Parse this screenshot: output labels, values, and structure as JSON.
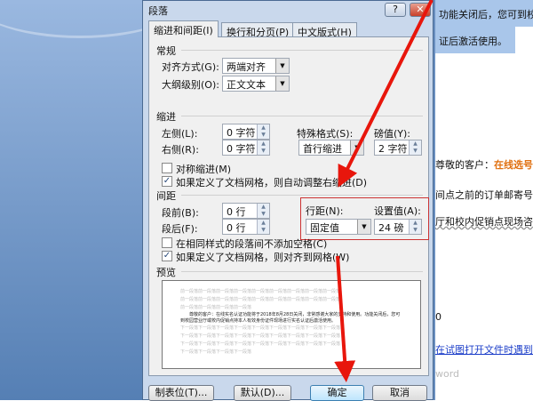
{
  "dialog": {
    "title": "段落",
    "help": "?",
    "close": "✕",
    "tabs": [
      "缩进和间距(I)",
      "换行和分页(P)",
      "中文版式(H)"
    ],
    "general": {
      "heading": "常规",
      "align_label": "对齐方式(G):",
      "align_value": "两端对齐",
      "outline_label": "大纲级别(O):",
      "outline_value": "正文文本"
    },
    "indent": {
      "heading": "缩进",
      "left_label": "左侧(L):",
      "left_value": "0 字符",
      "right_label": "右侧(R):",
      "right_value": "0 字符",
      "special_label": "特殊格式(S):",
      "special_value": "首行缩进",
      "by_label": "磅值(Y):",
      "by_value": "2 字符",
      "mirror": "对称缩进(M)",
      "auto_adjust": "如果定义了文档网格，则自动调整右缩进(D)"
    },
    "spacing": {
      "heading": "间距",
      "before_label": "段前(B):",
      "before_value": "0 行",
      "after_label": "段后(F):",
      "after_value": "0 行",
      "line_label": "行距(N):",
      "line_value": "固定值",
      "at_label": "设置值(A):",
      "at_value": "24 磅",
      "no_space": "在相同样式的段落间不添加空格(C)",
      "snap": "如果定义了文档网格，则对齐到网格(W)"
    },
    "preview": {
      "heading": "预览",
      "prev_lines": [
        "前一段落前一段落前一段落前一段落前一段落前一段落前一段落前一段落前一段落",
        "前一段落前一段落前一段落前一段落前一段落前一段落前一段落前一段落前一段落",
        "前一段落前一段落前一段落前一段落"
      ],
      "sample": "尊敬的客户：在线实名认证功能将于2018年8月28日关闭，非常感谢大家的支持和使用。功能关闭后，您可到校园营业厅或校内促销点持本人有效身份证件现场进行实名认证后激活使用。",
      "next_lines": [
        "下一段落下一段落下一段落下一段落下一段落下一段落下一段落下一段落下一段落",
        "下一段落下一段落下一段落下一段落下一段落下一段落下一段落下一段落下一段落",
        "下一段落下一段落下一段落下一段落下一段落下一段落下一段落下一段落下一段落",
        "下一段落下一段落下一段落下一段落"
      ]
    },
    "buttons": {
      "tabs": "制表位(T)...",
      "default": "默认(D)...",
      "ok": "确定",
      "cancel": "取消"
    }
  },
  "document": {
    "lines": [
      "功能关闭后，您可到校",
      "证后激活使用。",
      "尊敬的客户：",
      "在线选号",
      "间点之前的订单邮寄号",
      "厅和校内促销点现场咨",
      "0",
      "在试图打开文件时遇到",
      "word"
    ]
  },
  "colors": {
    "annotation": "#e8160c",
    "highlight": "#a9c6ea",
    "orange": "#e07010",
    "link": "#1a3cc8"
  }
}
